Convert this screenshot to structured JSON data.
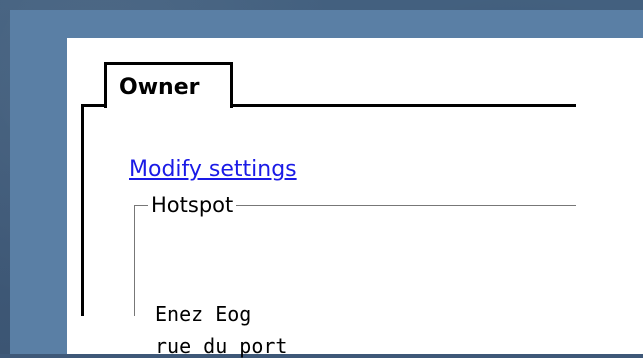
{
  "tabs": [
    {
      "label": "Owner"
    }
  ],
  "content": {
    "modify_link": "Modify settings",
    "hotspot": {
      "legend": "Hotspot",
      "address_lines": [
        "Enez Eog",
        "rue du port"
      ]
    }
  }
}
